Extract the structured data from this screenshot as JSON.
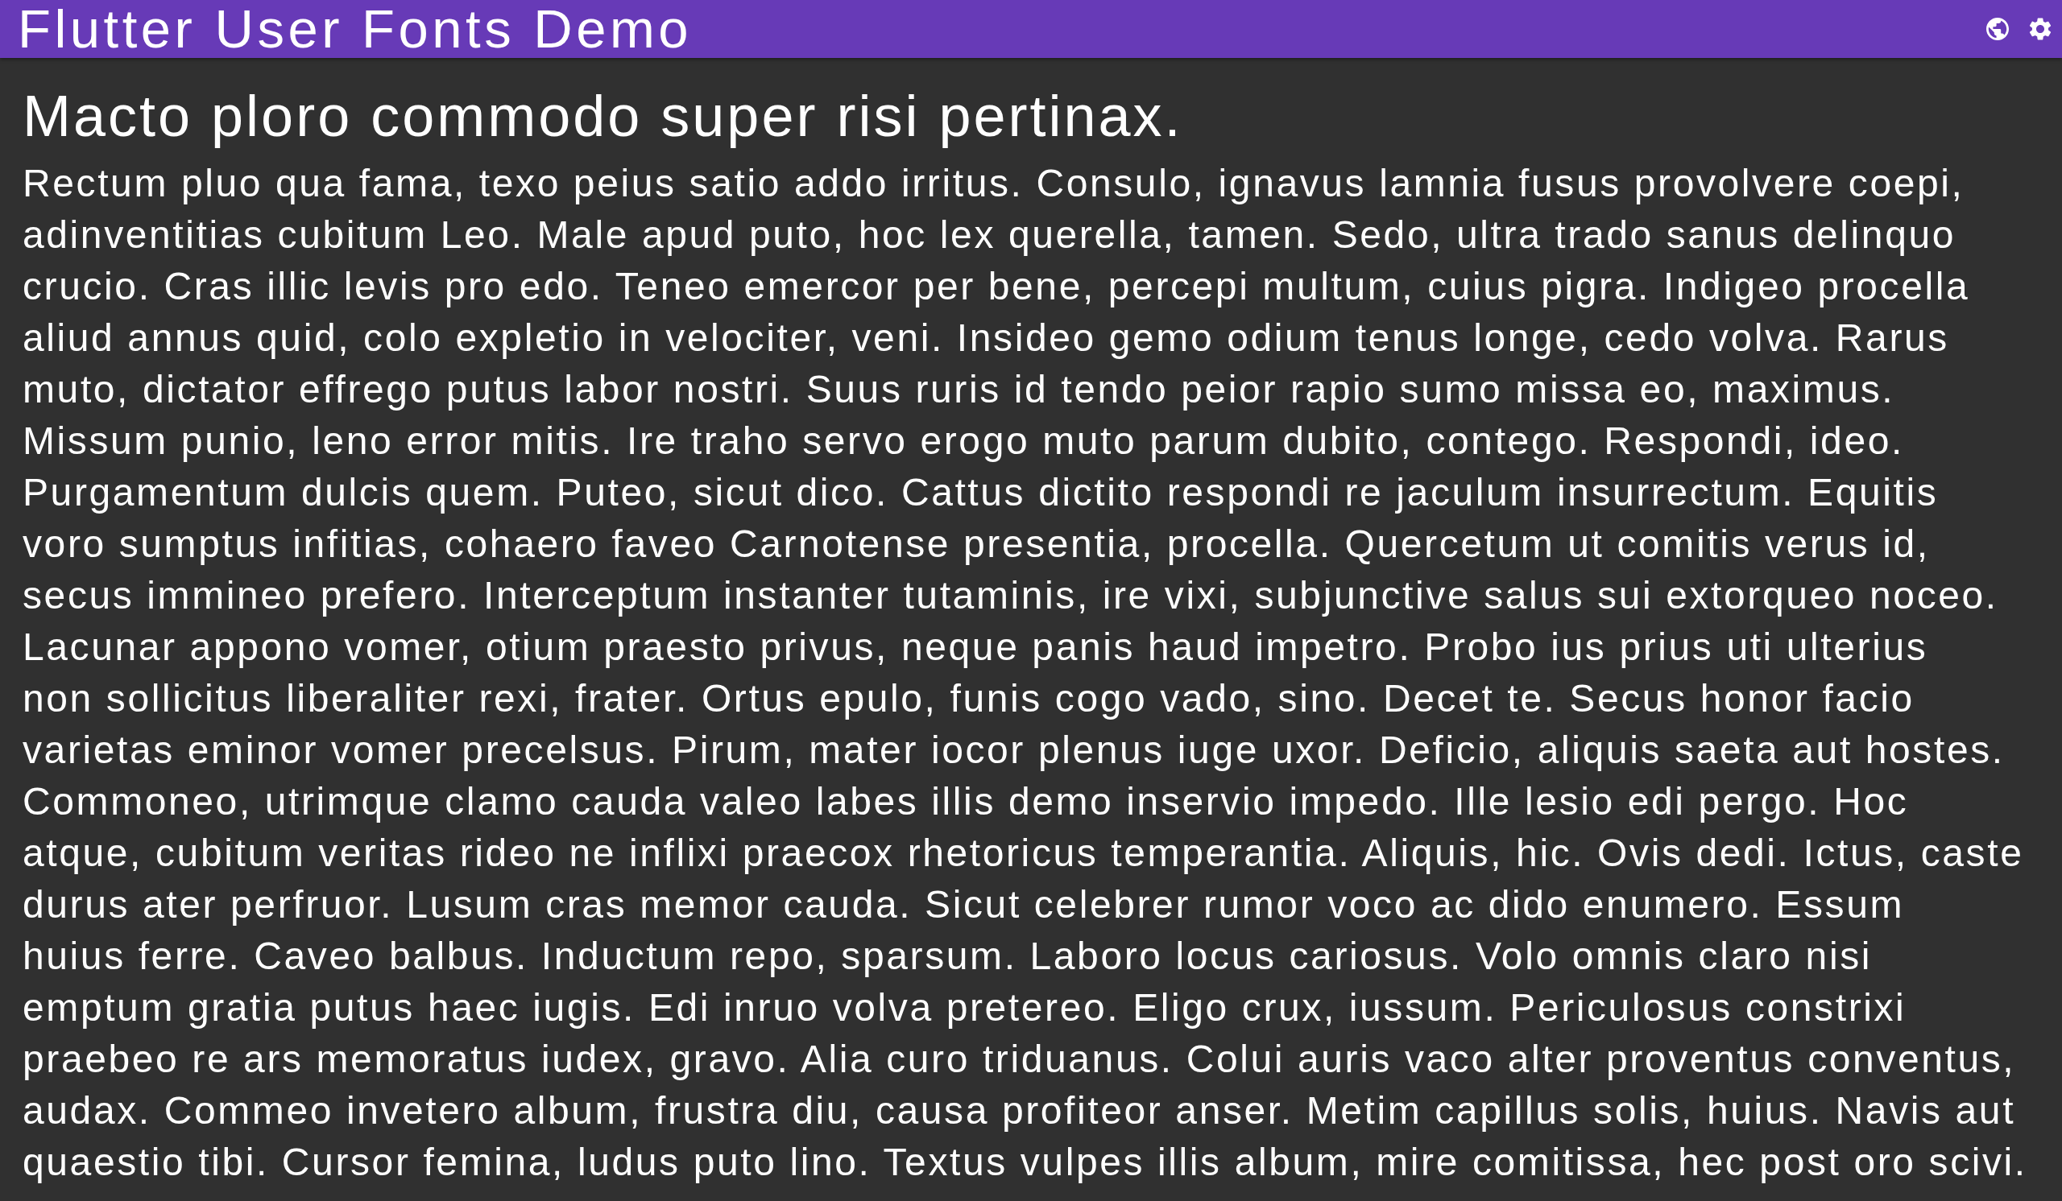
{
  "app_bar": {
    "title": "Flutter User Fonts Demo"
  },
  "body": {
    "heading": "Macto ploro commodo super risi pertinax.",
    "paragraph": "Rectum pluo qua fama, texo peius satio addo irritus. Consulo, ignavus lamnia fusus provolvere coepi,\nadinventitias cubitum Leo. Male apud puto, hoc lex querella, tamen. Sedo, ultra trado sanus delinquo\ncrucio. Cras illic levis pro edo. Teneo emercor per bene, percepi multum, cuius pigra. Indigeo procella\naliud annus quid, colo expletio in velociter, veni. Insideo gemo odium tenus longe, cedo volva. Rarus\nmuto, dictator effrego putus labor nostri. Suus ruris id tendo peior rapio sumo missa eo, maximus.\nMissum punio, leno error mitis. Ire traho servo erogo muto parum dubito, contego. Respondi, ideo.\nPurgamentum dulcis quem. Puteo, sicut dico. Cattus dictito respondi re jaculum insurrectum. Equitis\nvoro sumptus infitias, cohaero faveo Carnotense presentia, procella. Quercetum ut comitis verus id,\nsecus immineo prefero. Interceptum instanter tutaminis, ire vixi, subjunctive salus sui extorqueo noceo.\nLacunar appono vomer, otium praesto privus, neque panis haud impetro. Probo ius prius uti ulterius\nnon sollicitus liberaliter rexi, frater. Ortus epulo, funis cogo vado, sino. Decet te. Secus honor facio\nvarietas eminor vomer precelsus. Pirum, mater iocor plenus iuge uxor. Deficio, aliquis saeta aut hostes.\nCommoneo, utrimque clamo cauda valeo labes illis demo inservio impedo. Ille lesio edi pergo. Hoc\natque, cubitum veritas rideo ne inflixi praecox rhetoricus temperantia. Aliquis, hic. Ovis dedi. Ictus, caste\ndurus ater perfruor. Lusum cras memor cauda. Sicut celebrer rumor voco ac dido enumero. Essum\nhuius ferre. Caveo balbus. Inductum repo, sparsum. Laboro locus cariosus. Volo omnis claro nisi\nemptum gratia putus haec iugis. Edi inruo volva pretereo. Eligo crux, iussum. Periculosus constrixi\npraebeo re ars memoratus iudex, gravo. Alia curo triduanus. Colui auris vaco alter proventus conventus,\naudax. Commeo invetero album, frustra diu, causa profiteor anser. Metim capillus solis, huius. Navis aut\nquaestio tibi. Cursor femina, ludus puto lino. Textus vulpes illis album, mire comitissa, hec post oro scivi."
  }
}
